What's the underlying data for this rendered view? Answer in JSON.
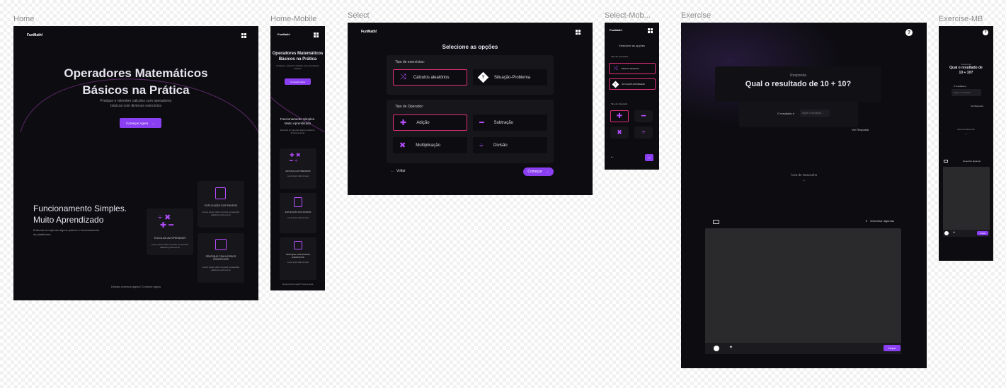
{
  "labels": {
    "home": "Home",
    "home_mobile": "Home-Mobile",
    "select": "Select",
    "select_mobile": "Select-Mob...",
    "exercise": "Exercise",
    "exercise_mb": "Exercise-MB"
  },
  "brand": "FunMath!",
  "colors": {
    "accent": "#8b3ff2",
    "pink": "#e0307c",
    "bg": "#0d0c10",
    "card": "#17161b"
  },
  "home": {
    "title_line1": "Operadores Matemáticos",
    "title_line2": "Básicos na Prática",
    "subtitle_line1": "Pratique e relembre cálculos com operadores",
    "subtitle_line2": "básicos com diversos exercícios",
    "cta": "Começar Agora",
    "section_title_line1": "Funcionamento Simples.",
    "section_title_line2": "Muito Aprendizado",
    "section_desc_line1": "Entenda em apenas alguns passos o funcionamento",
    "section_desc_line2": "da plataforma",
    "features": [
      {
        "title": "ESCOLHA UM OPERADOR",
        "desc": "Lorem ipsum dolor sit amet consectetur adipiscing elit sed do"
      },
      {
        "title": "EXPLICAÇÃO DOS PASSOS",
        "desc": "Lorem ipsum dolor sit amet consectetur adipiscing elit sed do"
      },
      {
        "title": "PRATIQUE COM NOSSOS EXERCÍCIOS",
        "desc": "Lorem ipsum dolor sit amet consectetur adipiscing elit sed do"
      }
    ],
    "footer": "Deseja comecar agora? Comece agora"
  },
  "home_mobile": {
    "title_line1": "Operadores Matemáticos",
    "title_line2": "Básicos na Prática",
    "subtitle": "Pratique e relembre cálculos com operadores básicos",
    "cta": "Começar Agora",
    "section_title_line1": "Funcionamento Simples.",
    "section_title_line2": "Muito Aprendizado",
    "section_desc": "Entenda em apenas alguns passos o funcionamento",
    "features": [
      {
        "title": "ESCOLHA UM OPERADOR",
        "desc": "Lorem ipsum dolor sit amet"
      },
      {
        "title": "EXPLICAÇÃO DOS PASSOS",
        "desc": "Lorem ipsum dolor sit amet"
      },
      {
        "title": "PRATIQUE COM NOSSOS EXERCÍCIOS",
        "desc": "Lorem ipsum dolor sit amet"
      }
    ],
    "footer": "Deseja comecar agora? Comece agora"
  },
  "select": {
    "title": "Selecione as opções",
    "type_label": "Tipo de exercícios:",
    "types": [
      "Cálculos aleatórios",
      "Situação-Problema"
    ],
    "op_label": "Tipo de Operador:",
    "operators": [
      "Adição",
      "Subtração",
      "Multiplicação",
      "Divisão"
    ],
    "back": "Voltar",
    "start": "Começar"
  },
  "select_mobile": {
    "title": "Selecione as opções",
    "type_label": "Tipo de exercícios",
    "types": [
      "Cálculos aleatórios",
      "SITUAÇÃO-PROBLEMA"
    ],
    "op_label": "Tipo de Operador"
  },
  "exercise": {
    "help": "?",
    "kicker": "Responda",
    "question": "Qual o resultado de 10 + 10?",
    "answer_label": "O resultado é",
    "answer_placeholder": "Digite o resultado...",
    "see_answer": "Ver Resposta",
    "draft_area": "Área de Rascunho",
    "eraser": "Desenhar algumas",
    "clear": "Limpar"
  },
  "exercise_mb": {
    "kicker": "Responda",
    "question_line1": "Qual o resultado de",
    "question_line2": "10 + 10?",
    "answer_label": "O resultado é",
    "answer_placeholder": "Digite o resultado...",
    "see_answer": "Ver Resposta",
    "draft_area": "Área de Rascunho",
    "eraser": "Desenhar algumas",
    "clear": "Limpar"
  }
}
